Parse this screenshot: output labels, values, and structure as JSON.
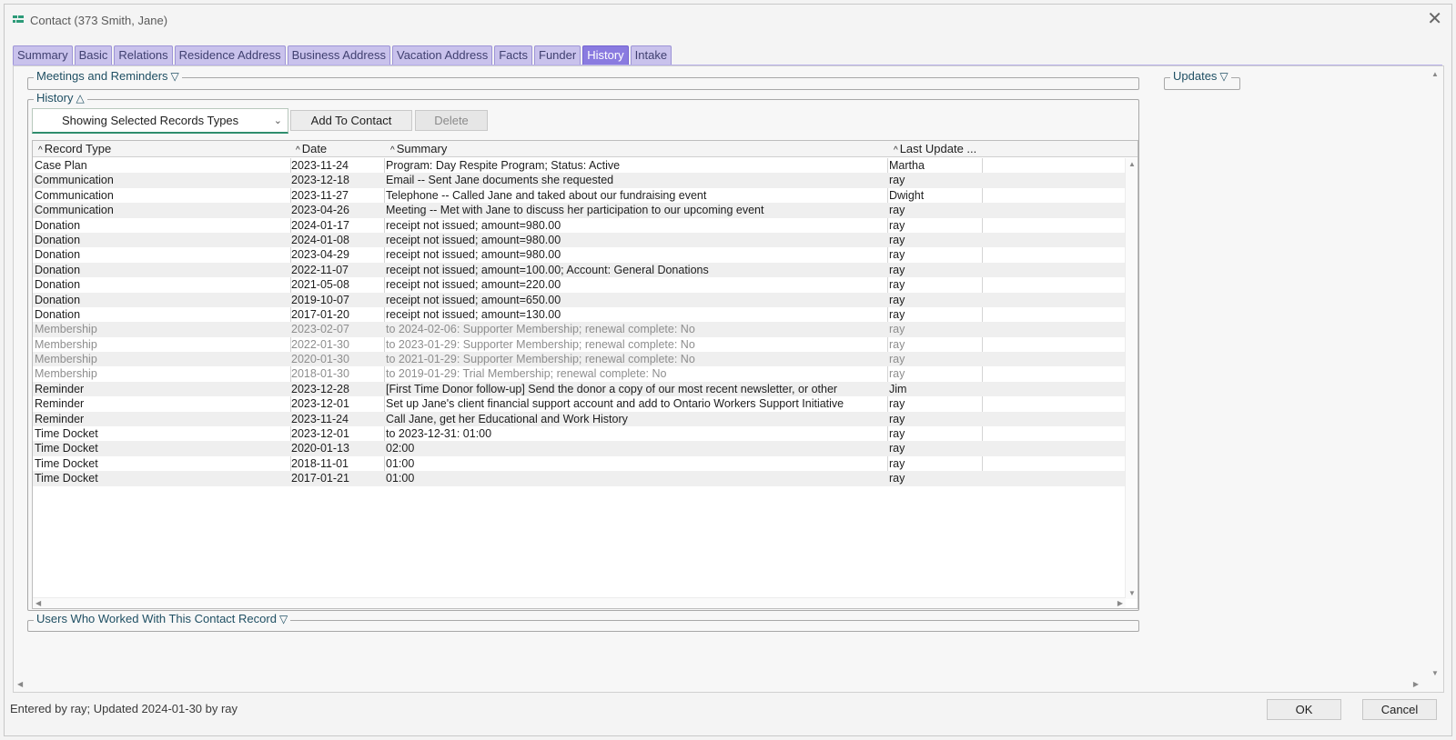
{
  "window": {
    "title": "Contact (373   Smith, Jane)",
    "close_glyph": "✕"
  },
  "tabs": [
    {
      "label": "Summary",
      "active": false
    },
    {
      "label": "Basic",
      "active": false
    },
    {
      "label": "Relations",
      "active": false
    },
    {
      "label": "Residence Address",
      "active": false
    },
    {
      "label": "Business Address",
      "active": false
    },
    {
      "label": "Vacation Address",
      "active": false
    },
    {
      "label": "Facts",
      "active": false
    },
    {
      "label": "Funder",
      "active": false
    },
    {
      "label": "History",
      "active": true
    },
    {
      "label": "Intake",
      "active": false
    }
  ],
  "sections": {
    "meetings": {
      "label": "Meetings and Reminders",
      "icon": "▽"
    },
    "updates": {
      "label": "Updates",
      "icon": "▽"
    },
    "history": {
      "label": "History",
      "icon": "△"
    },
    "users": {
      "label": "Users Who Worked With This Contact Record",
      "icon": "▽"
    }
  },
  "history": {
    "filter_value": "Showing Selected Records Types",
    "add_label": "Add To Contact",
    "delete_label": "Delete",
    "columns": [
      "Record Type",
      "Date",
      "Summary",
      "Last Update ..."
    ],
    "rows": [
      {
        "type": "Case Plan",
        "date": "2023-11-24",
        "summary": "Program: Day Respite Program; Status: Active",
        "user": "Martha",
        "muted": false
      },
      {
        "type": "Communication",
        "date": "2023-12-18",
        "summary": "Email -- Sent Jane documents she requested",
        "user": "ray",
        "muted": false
      },
      {
        "type": "Communication",
        "date": "2023-11-27",
        "summary": "Telephone -- Called Jane and taked about our fundraising event",
        "user": "Dwight",
        "muted": false
      },
      {
        "type": "Communication",
        "date": "2023-04-26",
        "summary": "Meeting -- Met with Jane to discuss her participation to our upcoming event",
        "user": "ray",
        "muted": false
      },
      {
        "type": "Donation",
        "date": "2024-01-17",
        "summary": "receipt not issued; amount=980.00",
        "user": "ray",
        "muted": false
      },
      {
        "type": "Donation",
        "date": "2024-01-08",
        "summary": "receipt not issued; amount=980.00",
        "user": "ray",
        "muted": false
      },
      {
        "type": "Donation",
        "date": "2023-04-29",
        "summary": "receipt not issued; amount=980.00",
        "user": "ray",
        "muted": false
      },
      {
        "type": "Donation",
        "date": "2022-11-07",
        "summary": "receipt not issued; amount=100.00; Account: General Donations",
        "user": "ray",
        "muted": false
      },
      {
        "type": "Donation",
        "date": "2021-05-08",
        "summary": "receipt not issued; amount=220.00",
        "user": "ray",
        "muted": false
      },
      {
        "type": "Donation",
        "date": "2019-10-07",
        "summary": "receipt not issued; amount=650.00",
        "user": "ray",
        "muted": false
      },
      {
        "type": "Donation",
        "date": "2017-01-20",
        "summary": "receipt not issued; amount=130.00",
        "user": "ray",
        "muted": false
      },
      {
        "type": "Membership",
        "date": "2023-02-07",
        "summary": "to 2024-02-06: Supporter Membership; renewal complete: No",
        "user": "ray",
        "muted": true
      },
      {
        "type": "Membership",
        "date": "2022-01-30",
        "summary": "to 2023-01-29: Supporter Membership; renewal complete: No",
        "user": "ray",
        "muted": true
      },
      {
        "type": "Membership",
        "date": "2020-01-30",
        "summary": "to 2021-01-29: Supporter Membership; renewal complete: No",
        "user": "ray",
        "muted": true
      },
      {
        "type": "Membership",
        "date": "2018-01-30",
        "summary": "to 2019-01-29: Trial Membership; renewal complete: No",
        "user": "ray",
        "muted": true
      },
      {
        "type": "Reminder",
        "date": "2023-12-28",
        "summary": "[First Time Donor follow-up] Send the donor a copy of our most recent newsletter, or other",
        "user": "Jim",
        "muted": false
      },
      {
        "type": "Reminder",
        "date": "2023-12-01",
        "summary": "Set up Jane's client financial support account and add to Ontario Workers Support Initiative",
        "user": "ray",
        "muted": false
      },
      {
        "type": "Reminder",
        "date": "2023-11-24",
        "summary": "Call Jane, get her Educational and Work History",
        "user": "ray",
        "muted": false
      },
      {
        "type": "Time Docket",
        "date": "2023-12-01",
        "summary": "to 2023-12-31: 01:00",
        "user": "ray",
        "muted": false
      },
      {
        "type": "Time Docket",
        "date": "2020-01-13",
        "summary": "02:00",
        "user": "ray",
        "muted": false
      },
      {
        "type": "Time Docket",
        "date": "2018-11-01",
        "summary": "01:00",
        "user": "ray",
        "muted": false
      },
      {
        "type": "Time Docket",
        "date": "2017-01-21",
        "summary": "01:00",
        "user": "ray",
        "muted": false
      }
    ]
  },
  "status_text": "Entered by ray; Updated 2024-01-30 by ray",
  "buttons": {
    "ok": "OK",
    "cancel": "Cancel"
  },
  "colors": {
    "tab": "#c9c2ec",
    "tab_active": "#8a7be0",
    "legend": "#1f4f63",
    "select_accent": "#2f8d6d"
  }
}
